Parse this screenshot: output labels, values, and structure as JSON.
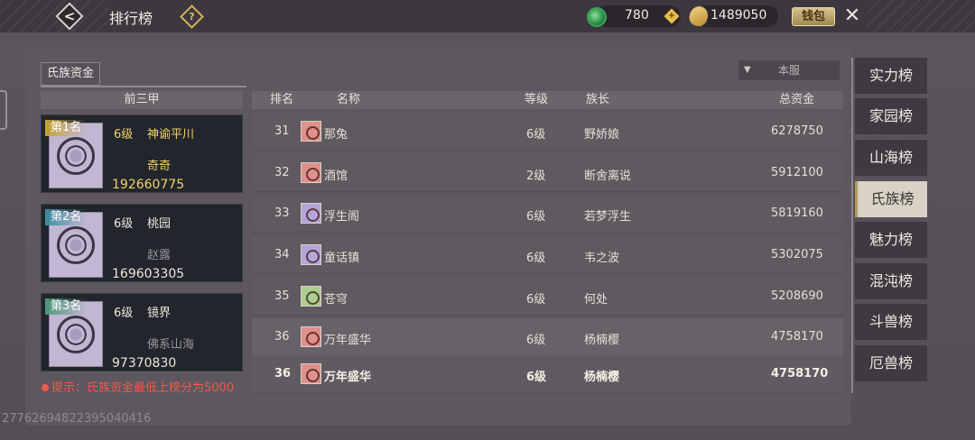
{
  "header": {
    "title": "排行榜",
    "help_label": "?",
    "jade": "780",
    "add_label": "+",
    "coins": "1489050",
    "wallet_label": "钱包",
    "close_label": "✕"
  },
  "tab": {
    "label": "氏族资金"
  },
  "server_select": {
    "selected": "本服"
  },
  "top_three": {
    "heading": "前三甲",
    "cards": [
      {
        "rank": "第1名",
        "level": "6级",
        "clan": "神谕平川",
        "chief": "奇奇",
        "fund": "192660775",
        "badge_color": "#c9a63a"
      },
      {
        "rank": "第2名",
        "level": "6级",
        "clan": "桃园",
        "chief": "赵露",
        "fund": "169603305",
        "badge_color": "#3f8fa0"
      },
      {
        "rank": "第3名",
        "level": "6级",
        "clan": "镜界",
        "chief": "佛系山海",
        "fund": "97370830",
        "badge_color": "#4f9a7c"
      }
    ],
    "hint": "提示：氏族资金最低上榜分为5000"
  },
  "table": {
    "headers": {
      "rank": "排名",
      "name": "名称",
      "level": "等级",
      "chief": "族长",
      "fund": "总资金"
    },
    "rows": [
      {
        "rank": "31",
        "name": "那兔",
        "level": "6级",
        "chief": "野娇娘",
        "fund": "6278750",
        "icon": "red-clan-emblem-icon",
        "icon_color": "#e0908a"
      },
      {
        "rank": "32",
        "name": "酒馆",
        "level": "2级",
        "chief": "断舍离说",
        "fund": "5912100",
        "icon": "red-clan-emblem-icon",
        "icon_color": "#e0908a"
      },
      {
        "rank": "33",
        "name": "浮生阁",
        "level": "6级",
        "chief": "若梦浮生",
        "fund": "5819160",
        "icon": "purple-clan-emblem-icon",
        "icon_color": "#b4a6d8"
      },
      {
        "rank": "34",
        "name": "童话镇",
        "level": "6级",
        "chief": "韦之波",
        "fund": "5302075",
        "icon": "purple-clan-emblem-icon",
        "icon_color": "#b4a6d8"
      },
      {
        "rank": "35",
        "name": "苍穹",
        "level": "6级",
        "chief": "何处",
        "fund": "5208690",
        "icon": "green-clan-emblem-icon",
        "icon_color": "#a9cf8e"
      },
      {
        "rank": "36",
        "name": "万年盛华",
        "level": "6级",
        "chief": "杨楠樱",
        "fund": "4758170",
        "icon": "red-clan-emblem-icon",
        "icon_color": "#e0908a"
      }
    ],
    "mine": {
      "rank": "36",
      "name": "万年盛华",
      "level": "6级",
      "chief": "杨楠樱",
      "fund": "4758170",
      "icon": "red-clan-emblem-icon",
      "icon_color": "#e0908a"
    }
  },
  "side_tabs": [
    "实力榜",
    "家园榜",
    "山海榜",
    "氏族榜",
    "魅力榜",
    "混沌榜",
    "斗兽榜",
    "厄兽榜"
  ],
  "active_side_tab": "氏族榜",
  "user_id": "2776269482239504041​6"
}
